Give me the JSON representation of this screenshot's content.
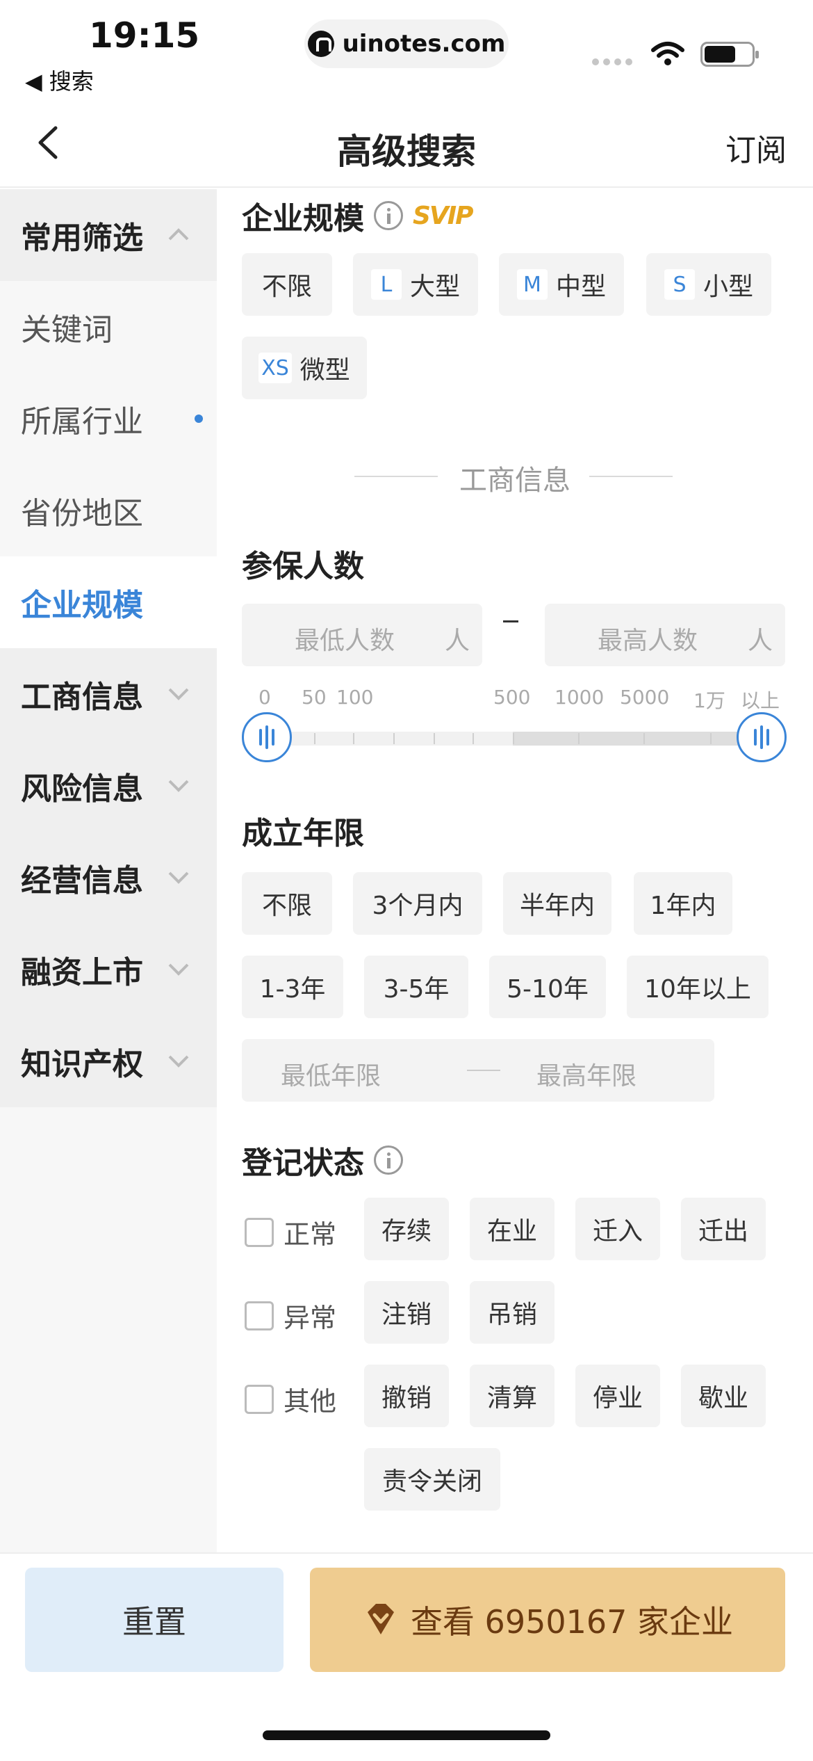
{
  "status": {
    "time": "19:15",
    "back_app": "◀ 搜索",
    "url": "uinotes.com"
  },
  "nav": {
    "title": "高级搜索",
    "subscribe": "订阅"
  },
  "sidebar": {
    "items": [
      {
        "label": "常用筛选",
        "type": "group",
        "expanded": true
      },
      {
        "label": "关键词",
        "type": "sub"
      },
      {
        "label": "所属行业",
        "type": "sub",
        "dot": true
      },
      {
        "label": "省份地区",
        "type": "sub"
      },
      {
        "label": "企业规模",
        "type": "active"
      },
      {
        "label": "工商信息",
        "type": "group"
      },
      {
        "label": "风险信息",
        "type": "group"
      },
      {
        "label": "经营信息",
        "type": "group"
      },
      {
        "label": "融资上市",
        "type": "group"
      },
      {
        "label": "知识产权",
        "type": "group"
      }
    ]
  },
  "scale": {
    "title": "企业规模",
    "vip_badge": "SVIP",
    "options": [
      {
        "label": "不限"
      },
      {
        "badge": "L",
        "label": "大型"
      },
      {
        "badge": "M",
        "label": "中型"
      },
      {
        "badge": "S",
        "label": "小型"
      },
      {
        "badge": "XS",
        "label": "微型"
      }
    ]
  },
  "divider": {
    "label": "工商信息"
  },
  "insured": {
    "title": "参保人数",
    "min_placeholder": "最低人数",
    "max_placeholder": "最高人数",
    "unit": "人",
    "ticks": [
      "0",
      "50",
      "100",
      "500",
      "1000",
      "5000",
      "1万",
      "以上"
    ],
    "selected_range": [
      0,
      1
    ]
  },
  "established": {
    "title": "成立年限",
    "options": [
      "不限",
      "3个月内",
      "半年内",
      "1年内",
      "1-3年",
      "3-5年",
      "5-10年",
      "10年以上"
    ],
    "min_placeholder": "最低年限",
    "max_placeholder": "最高年限"
  },
  "registration": {
    "title": "登记状态",
    "groups": [
      {
        "label": "正常",
        "options": [
          "存续",
          "在业",
          "迁入",
          "迁出"
        ]
      },
      {
        "label": "异常",
        "options": [
          "注销",
          "吊销"
        ]
      },
      {
        "label": "其他",
        "options": [
          "撤销",
          "清算",
          "停业",
          "歇业",
          "责令关闭"
        ]
      }
    ]
  },
  "footer": {
    "reset": "重置",
    "view": "查看 6950167 家企业"
  },
  "colors": {
    "accent": "#3a85d8",
    "gold": "#efcc90",
    "vip": "#e6a51f"
  }
}
